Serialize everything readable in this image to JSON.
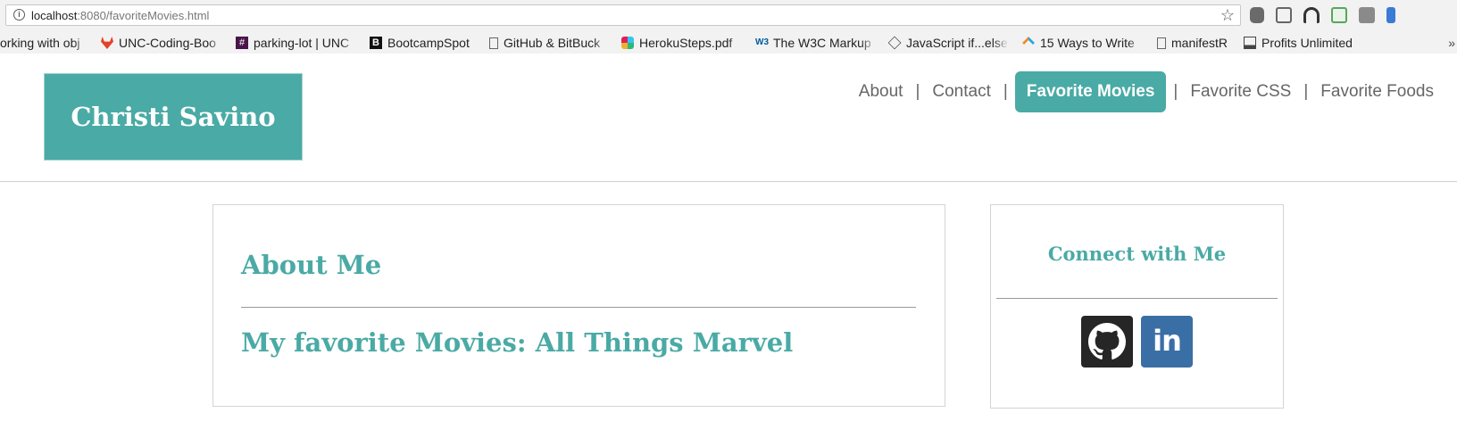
{
  "browser": {
    "url_host": "localhost",
    "url_rest": ":8080/favoriteMovies.html",
    "bookmarks": [
      {
        "label": "orking with obj",
        "icon": "page-icon"
      },
      {
        "label": "UNC-Coding-Boo",
        "icon": "gitlab-icon"
      },
      {
        "label": "parking-lot | UNC",
        "icon": "slack-channel-icon"
      },
      {
        "label": "BootcampSpot",
        "icon": "bootcampspot-icon"
      },
      {
        "label": "GitHub & BitBuck",
        "icon": "page-icon"
      },
      {
        "label": "HerokuSteps.pdf",
        "icon": "slack-icon"
      },
      {
        "label": "The W3C Markup",
        "icon": "w3c-icon"
      },
      {
        "label": "JavaScript if...else",
        "icon": "diamond-icon"
      },
      {
        "label": "15 Ways to Write",
        "icon": "sitepoint-icon"
      },
      {
        "label": "manifestR",
        "icon": "page-icon"
      },
      {
        "label": "Profits Unlimited",
        "icon": "profits-icon"
      }
    ],
    "more_glyph": "»"
  },
  "site": {
    "brand": "Christi Savino",
    "nav": [
      {
        "label": "About",
        "active": false
      },
      {
        "label": "Contact",
        "active": false
      },
      {
        "label": "Favorite Movies",
        "active": true
      },
      {
        "label": "Favorite CSS",
        "active": false
      },
      {
        "label": "Favorite Foods",
        "active": false
      }
    ],
    "nav_separator": "|",
    "accent_color": "#4aaaa5"
  },
  "main": {
    "about_title": "About Me",
    "movies_title": "My favorite Movies: All Things Marvel"
  },
  "sidebar": {
    "connect_title": "Connect with Me",
    "linkedin_text": "in"
  }
}
